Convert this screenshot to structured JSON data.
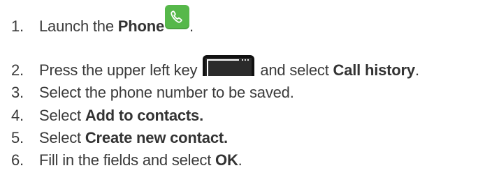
{
  "steps": [
    {
      "number": "1.",
      "prefix": "Launch the ",
      "bold": "Phone",
      "suffix": ".",
      "icon": "phone-app-icon"
    },
    {
      "number": "2.",
      "prefix": "Press the upper left key",
      "icon": "upper-left-key-icon",
      "middle": "and select ",
      "bold": "Call history",
      "suffix": "."
    },
    {
      "number": "3.",
      "prefix": "Select the phone number to be saved."
    },
    {
      "number": "4.",
      "prefix": "Select ",
      "bold": "Add to contacts."
    },
    {
      "number": "5.",
      "prefix": "Select ",
      "bold": "Create new contact."
    },
    {
      "number": "6.",
      "prefix": "Fill in the fields and select ",
      "bold": "OK",
      "suffix": "."
    }
  ],
  "colors": {
    "text": "#3a3a3a",
    "phone_icon_bg": "#56b84a",
    "key_icon_bg": "#111111"
  }
}
